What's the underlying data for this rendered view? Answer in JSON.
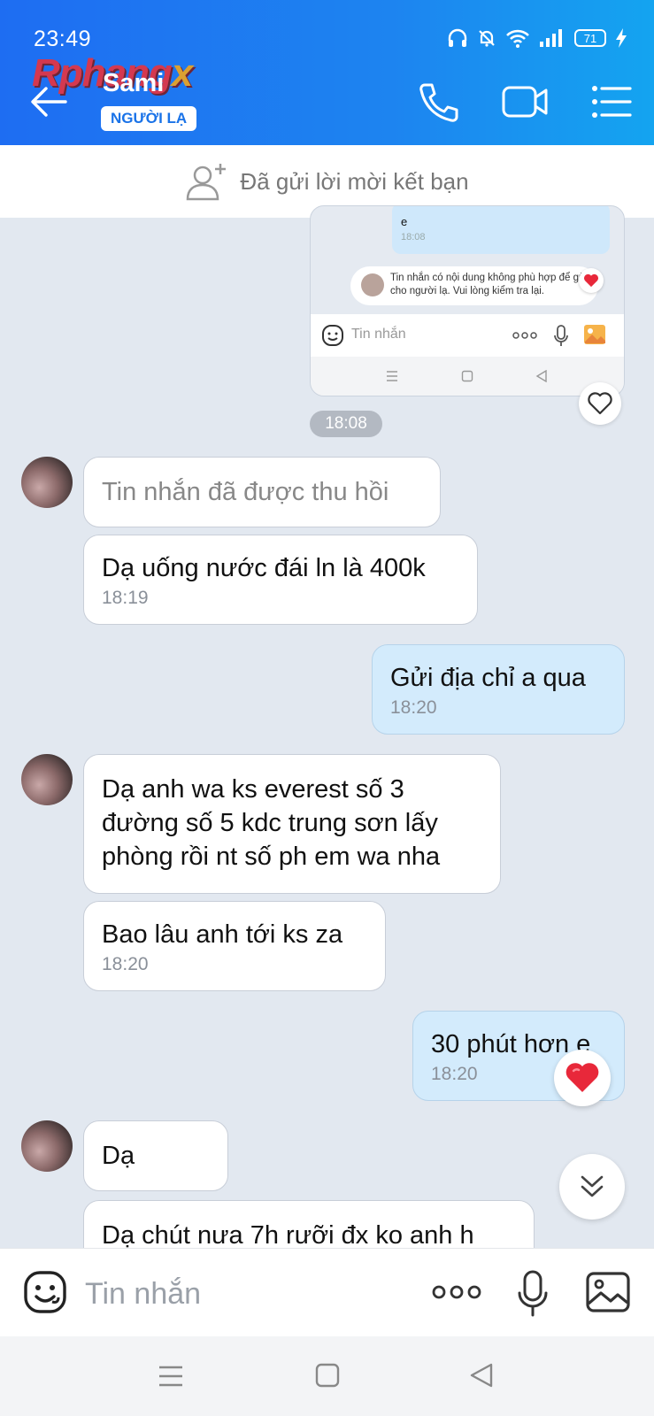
{
  "status": {
    "time": "23:49",
    "battery": "71"
  },
  "watermark": {
    "main": "Rphang",
    "accent": "x"
  },
  "header": {
    "contact_name": "Sami",
    "badge": "NGƯỜI LẠ"
  },
  "friend_request": {
    "text": "Đã gửi lời mời kết bạn"
  },
  "quoted_screenshot": {
    "bubble_text": "e",
    "bubble_time": "18:08",
    "notice": "Tin nhắn có nội dung không phù hợp để gửi cho người lạ. Vui lòng kiểm tra lại.",
    "input_placeholder": "Tin nhắn"
  },
  "time_divider": "18:08",
  "messages": [
    {
      "side": "in",
      "text": "Tin nhắn đã được thu hồi",
      "time": ""
    },
    {
      "side": "in",
      "text": "Dạ uống nước đái ln là 400k",
      "time": "18:19"
    },
    {
      "side": "out",
      "text": "Gửi địa chỉ a qua",
      "time": "18:20"
    },
    {
      "side": "in",
      "text": "Dạ anh wa ks everest số 3 đường số 5 kdc trung sơn lấy phòng rồi nt số ph em wa nha",
      "time": ""
    },
    {
      "side": "in",
      "text": "Bao lâu anh tới ks za",
      "time": "18:20"
    },
    {
      "side": "out",
      "text": "30 phút hơn e",
      "time": "18:20"
    },
    {
      "side": "in",
      "text": "Dạ",
      "time": ""
    },
    {
      "side": "in",
      "text": "Dạ chút nưa 7h rưỡi đx ko anh h",
      "time": ""
    }
  ],
  "message_lines": {
    "m3_line1": "Dạ anh wa ks everest số 3",
    "m3_line2": "đường số 5 kdc trung sơn lấy",
    "m3_line3": "phòng rồi nt số ph em wa nha"
  },
  "composer": {
    "placeholder": "Tin nhắn"
  },
  "colors": {
    "header_start": "#1e6df2",
    "header_end": "#14a4f0",
    "out_bubble": "#d3ebfc",
    "heart": "#e8283a"
  }
}
